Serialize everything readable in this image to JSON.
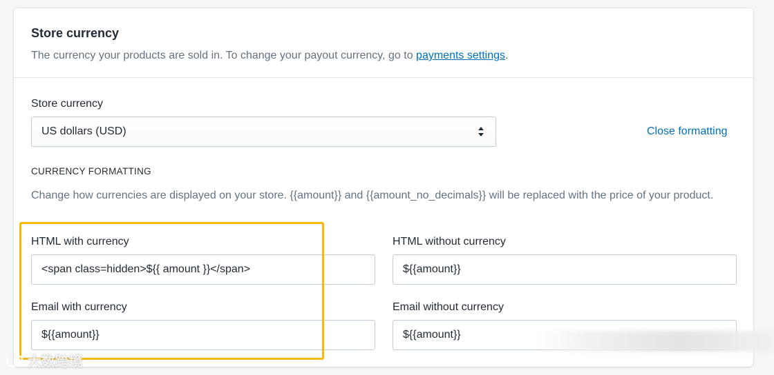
{
  "header": {
    "title": "Store currency",
    "description_prefix": "The currency your products are sold in. To change your payout currency, go to ",
    "description_link": "payments settings",
    "description_suffix": "."
  },
  "store_currency": {
    "label": "Store currency",
    "selected": "US dollars (USD)",
    "close_link": "Close formatting"
  },
  "formatting": {
    "heading": "CURRENCY FORMATTING",
    "description": "Change how currencies are displayed on your store. {{amount}} and {{amount_no_decimals}} will be replaced with the price of your product.",
    "html_with_currency": {
      "label": "HTML with currency",
      "value": "<span class=hidden>${{ amount }}</span>"
    },
    "html_without_currency": {
      "label": "HTML without currency",
      "value": "${{amount}}"
    },
    "email_with_currency": {
      "label": "Email with currency",
      "value": "${{amount}}"
    },
    "email_without_currency": {
      "label": "Email without currency",
      "value": "${{amount}}"
    }
  },
  "watermark": "大数跨境",
  "colors": {
    "link": "#006fbb",
    "highlight": "#f7b80b",
    "text": "#212b36",
    "subdued": "#637381"
  }
}
